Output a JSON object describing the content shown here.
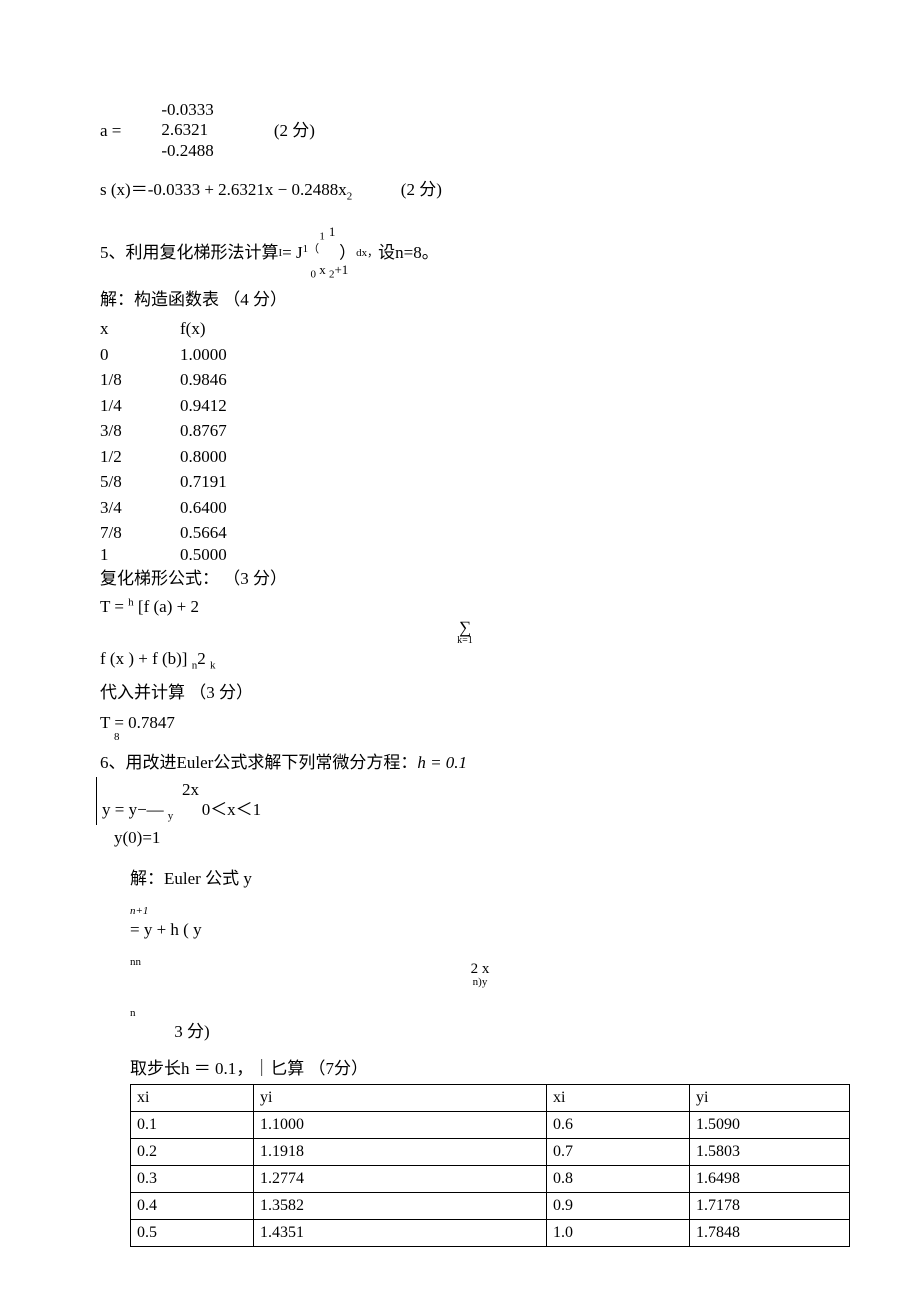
{
  "a_vec": {
    "v1": "-0.0333",
    "v2": "2.6321",
    "v3": "-0.2488",
    "prefix": "a =",
    "score": "(2 分)"
  },
  "s_line": {
    "text": "s (x)＝-0.0333 + 2.6321x − 0.2488x",
    "sub2": "2",
    "score": "(2 分)"
  },
  "q5": {
    "prefix": "5、利用复化梯形法计算",
    "eq_top_sup1": "1",
    "eq_top_one": "1",
    "eq_I": "I",
    "eq_eq": " = J",
    "eq_J_sup": "1（",
    "eq_paren_close": "）",
    "eq_dx": "dx，",
    "eq_bot_zero": "0",
    "eq_bot_x2p1": " x ",
    "eq_bot_sub2": "2",
    "eq_bot_plus1": "+1",
    "setn": "设n=8。",
    "solution_head": "解：构造函数表  （4 分）",
    "headers": {
      "x": "x",
      "fx": "f(x)"
    },
    "rows": [
      {
        "x": "0",
        "fx": "1.0000"
      },
      {
        "x": "1/8",
        "fx": "0.9846"
      },
      {
        "x": "1/4",
        "fx": "0.9412"
      },
      {
        "x": "3/8",
        "fx": "0.8767"
      },
      {
        "x": "1/2",
        "fx": "0.8000"
      },
      {
        "x": "5/8",
        "fx": "0.7191"
      },
      {
        "x": "3/4",
        "fx": "0.6400"
      },
      {
        "x": "7/8",
        "fx": "0.5664"
      },
      {
        "x": "1",
        "fx": "0.5000"
      }
    ],
    "formula_head": "复化梯形公式：  （3 分）",
    "T_left": " T = ",
    "T_h_sup": "h",
    "T_mid1": " [f (a) + 2",
    "T_sum_sym": "∑",
    "T_sum_sub": "k=1",
    "T_mid2": " f (x ) + f (b)] ",
    "T_tail_n": "n",
    "T_tail_2": "2 ",
    "T_tail_k": "k",
    "calc_head": "代入并计算        （3 分）",
    "T_res_top": "T = 0.7847",
    "T_res_sub": "8"
  },
  "q6": {
    "prefix": "6、用改进Euler公式求解下列常微分方程：",
    "h": "h = 0.1",
    "ode_top_2x": "2x",
    "ode_line": "y = y−—",
    "ode_sub": "y",
    "ode_range": "0＜x＜1",
    "ode_init": "y(0)=1",
    "sol_prefix": "解：Euler 公式  y",
    "sol_n1": "n+1",
    "sol_mid": " = y + h ( y",
    "sol_nn": "nn",
    "sol_frac_top": "2 x",
    "sol_frac_nb": "n)y",
    "sol_frac_n": "n",
    "sol_score": "  3 分)",
    "step_head": "取步长h ＝ 0.1，｜匕算      （7分）",
    "tbl_headers": [
      "xi",
      "yi",
      "xi",
      "yi"
    ],
    "tbl_rows": [
      [
        "0.1",
        "1.1000",
        "0.6",
        "1.5090"
      ],
      [
        "0.2",
        "1.1918",
        "0.7",
        "1.5803"
      ],
      [
        "0.3",
        "1.2774",
        "0.8",
        "1.6498"
      ],
      [
        "0.4",
        "1.3582",
        "0.9",
        "1.7178"
      ],
      [
        "0.5",
        "1.4351",
        "1.0",
        "1.7848"
      ]
    ]
  }
}
